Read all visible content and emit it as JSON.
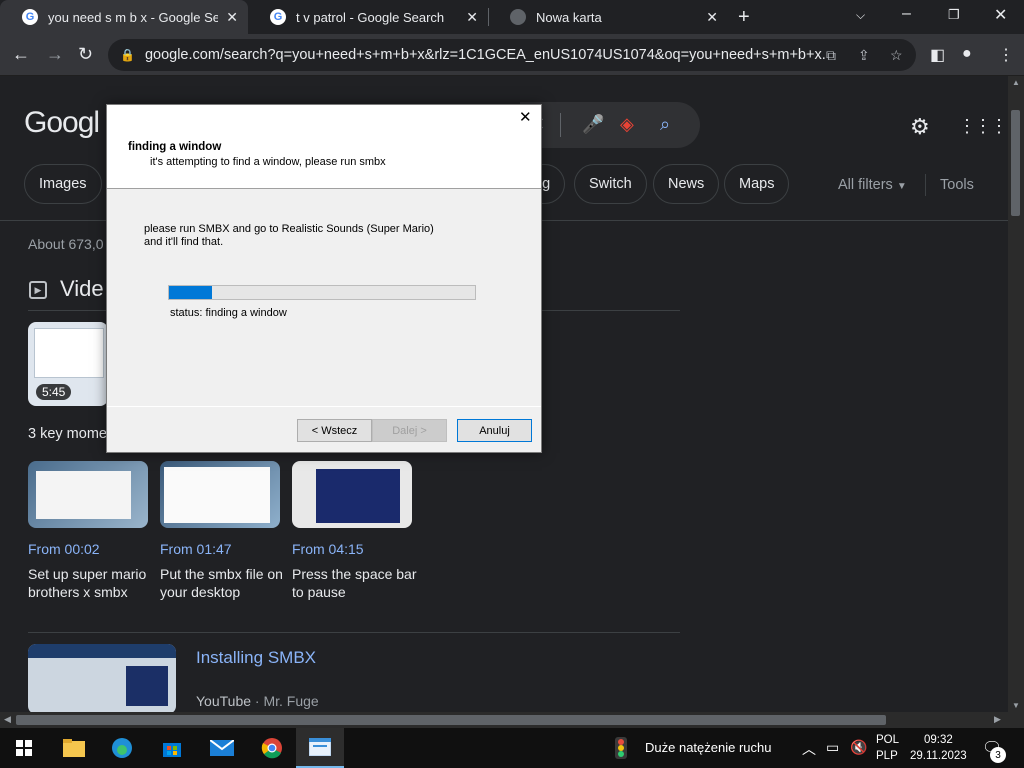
{
  "browser": {
    "tabs": [
      {
        "title": "you need s m b x - Google Search",
        "close": "✕"
      },
      {
        "title": "t v patrol - Google Search",
        "close": "✕"
      },
      {
        "title": "Nowa karta",
        "close": "✕"
      }
    ],
    "url": "google.com/search?q=you+need+s+m+b+x&rlz=1C1GCEA_enUS1074US1074&oq=you+need+s+m+b+x...",
    "icons": [
      "back-icon",
      "forward-icon",
      "reload-icon",
      "lock-icon",
      "translate-icon",
      "share-icon",
      "star-icon",
      "sidepanel-icon",
      "profile-icon",
      "menu-icon"
    ]
  },
  "google": {
    "logo": "Googl",
    "chips": [
      "Images",
      "ng",
      "Switch",
      "News",
      "Maps"
    ],
    "all_filters": "All filters",
    "tools": "Tools",
    "about": "About 673,0",
    "videos_title": "Vide",
    "main_video_duration": "5:45",
    "key_moments": "3 key mome",
    "moments": [
      {
        "from": "From 00:02",
        "desc": "Set up super mario brothers x smbx"
      },
      {
        "from": "From 01:47",
        "desc": "Put the smbx file on your desktop"
      },
      {
        "from": "From 04:15",
        "desc": "Press the space bar to pause"
      }
    ],
    "result_title": "Installing SMBX",
    "result_source": "YouTube",
    "result_author": " · Mr. Fuge"
  },
  "dialog": {
    "close": "✕",
    "heading": "finding a window",
    "subheading": "it's attempting to find a window, please run smbx",
    "body": "please run SMBX and go to Realistic Sounds (Super Mario)\nand it'll find that.",
    "progress_fraction": 0.14,
    "status": "status: finding a window",
    "back_label": "< Wstecz",
    "next_label": "Dalej >",
    "cancel_label": "Anuluj"
  },
  "taskbar": {
    "traffic_label": "Duże natężenie ruchu",
    "lang_top": "POL",
    "lang_bottom": "PLP",
    "time": "09:32",
    "date": "29.11.2023",
    "notifications": "3"
  }
}
